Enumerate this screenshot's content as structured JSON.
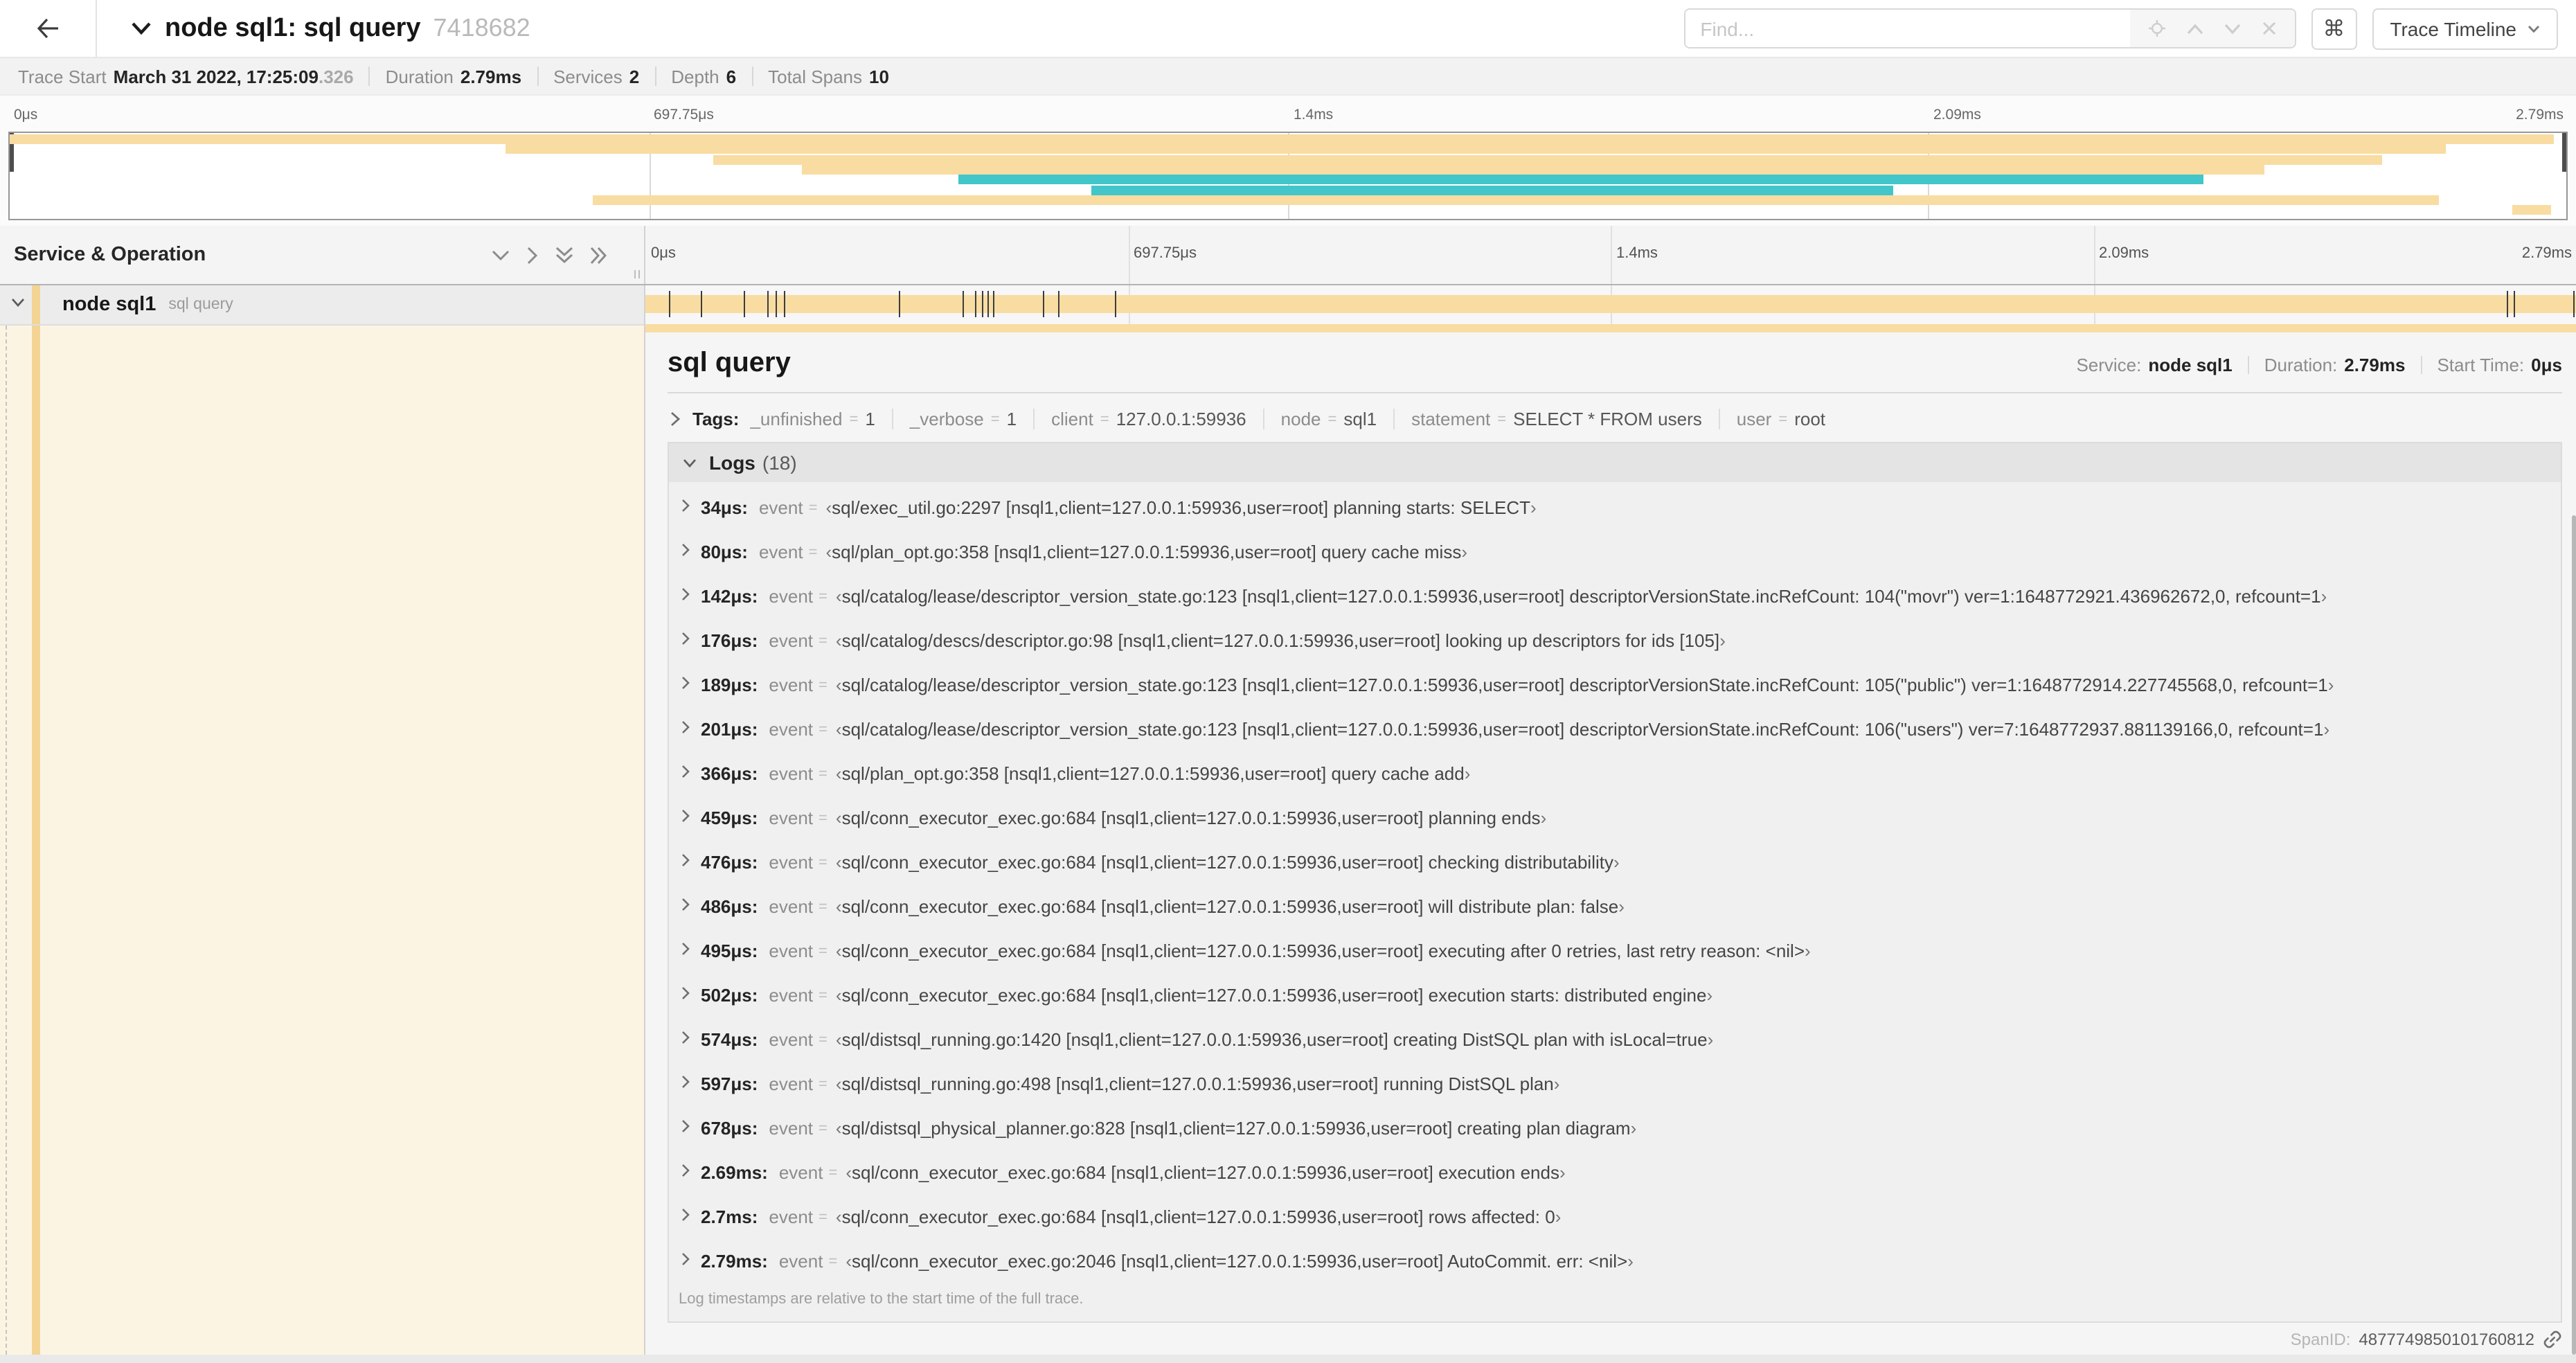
{
  "header": {
    "back_icon": "left-arrow",
    "collapse_icon": "chevron-down",
    "title": "node sql1: sql query",
    "trace_id": "7418682",
    "find_placeholder": "Find...",
    "shortcut_button": "⌘",
    "view_selector": "Trace Timeline"
  },
  "summary": {
    "items": [
      {
        "label": "Trace Start",
        "value": "March 31 2022, 17:25:09",
        "suffix": ".326"
      },
      {
        "label": "Duration",
        "value": "2.79ms",
        "suffix": ""
      },
      {
        "label": "Services",
        "value": "2",
        "suffix": ""
      },
      {
        "label": "Depth",
        "value": "6",
        "suffix": ""
      },
      {
        "label": "Total Spans",
        "value": "10",
        "suffix": ""
      }
    ]
  },
  "colors": {
    "service_node_sql1": "#F8DCA1",
    "service_secondary": "#42C6CA",
    "row_stripe": "#F3D494",
    "detail_tint": "#FCF4E2"
  },
  "minimap": {
    "tick_labels": [
      "0μs",
      "697.75μs",
      "1.4ms",
      "2.09ms",
      "2.79ms"
    ],
    "spans": [
      {
        "row": 0,
        "start": 0,
        "end": 99.5,
        "color": "service_node_sql1"
      },
      {
        "row": 1,
        "start": 19.4,
        "end": 95.3,
        "color": "service_node_sql1"
      },
      {
        "row": 2,
        "start": 27.5,
        "end": 92.8,
        "color": "service_node_sql1"
      },
      {
        "row": 3,
        "start": 31.0,
        "end": 88.2,
        "color": "service_node_sql1"
      },
      {
        "row": 4,
        "start": 37.1,
        "end": 85.8,
        "color": "service_secondary"
      },
      {
        "row": 5,
        "start": 42.3,
        "end": 73.7,
        "color": "service_secondary"
      },
      {
        "row": 6,
        "start": 22.8,
        "end": 95.0,
        "color": "service_node_sql1"
      },
      {
        "row": 7,
        "start": 97.9,
        "end": 99.4,
        "color": "service_node_sql1"
      }
    ]
  },
  "timeline": {
    "left_header": "Service & Operation",
    "ruler_ticks": [
      "0μs",
      "697.75μs",
      "1.4ms",
      "2.09ms",
      "2.79ms"
    ],
    "duration_us": 2790,
    "row": {
      "service": "node sql1",
      "operation": "sql query"
    },
    "log_marks_us": [
      34,
      80,
      142,
      176,
      189,
      201,
      366,
      459,
      476,
      486,
      495,
      502,
      574,
      597,
      678,
      2690,
      2700,
      2790
    ]
  },
  "detail": {
    "operation": "sql query",
    "meta": [
      {
        "label": "Service:",
        "value": "node sql1"
      },
      {
        "label": "Duration:",
        "value": "2.79ms"
      },
      {
        "label": "Start Time:",
        "value": "0μs"
      }
    ],
    "tags_label": "Tags:",
    "tags": [
      {
        "key": "_unfinished",
        "value": "1"
      },
      {
        "key": "_verbose",
        "value": "1"
      },
      {
        "key": "client",
        "value": "127.0.0.1:59936"
      },
      {
        "key": "node",
        "value": "sql1"
      },
      {
        "key": "statement",
        "value": "SELECT * FROM users"
      },
      {
        "key": "user",
        "value": "root"
      }
    ],
    "logs_label": "Logs",
    "logs_count": "(18)",
    "log_field_name": "event",
    "logs": [
      {
        "time": "34μs:",
        "value": "sql/exec_util.go:2297 [nsql1,client=127.0.0.1:59936,user=root] planning starts: SELECT"
      },
      {
        "time": "80μs:",
        "value": "sql/plan_opt.go:358 [nsql1,client=127.0.0.1:59936,user=root] query cache miss"
      },
      {
        "time": "142μs:",
        "value": "sql/catalog/lease/descriptor_version_state.go:123 [nsql1,client=127.0.0.1:59936,user=root] descriptorVersionState.incRefCount: 104(\"movr\") ver=1:1648772921.436962672,0, refcount=1"
      },
      {
        "time": "176μs:",
        "value": "sql/catalog/descs/descriptor.go:98 [nsql1,client=127.0.0.1:59936,user=root] looking up descriptors for ids [105]"
      },
      {
        "time": "189μs:",
        "value": "sql/catalog/lease/descriptor_version_state.go:123 [nsql1,client=127.0.0.1:59936,user=root] descriptorVersionState.incRefCount: 105(\"public\") ver=1:1648772914.227745568,0, refcount=1"
      },
      {
        "time": "201μs:",
        "value": "sql/catalog/lease/descriptor_version_state.go:123 [nsql1,client=127.0.0.1:59936,user=root] descriptorVersionState.incRefCount: 106(\"users\") ver=7:1648772937.881139166,0, refcount=1"
      },
      {
        "time": "366μs:",
        "value": "sql/plan_opt.go:358 [nsql1,client=127.0.0.1:59936,user=root] query cache add"
      },
      {
        "time": "459μs:",
        "value": "sql/conn_executor_exec.go:684 [nsql1,client=127.0.0.1:59936,user=root] planning ends"
      },
      {
        "time": "476μs:",
        "value": "sql/conn_executor_exec.go:684 [nsql1,client=127.0.0.1:59936,user=root] checking distributability"
      },
      {
        "time": "486μs:",
        "value": "sql/conn_executor_exec.go:684 [nsql1,client=127.0.0.1:59936,user=root] will distribute plan: false"
      },
      {
        "time": "495μs:",
        "value": "sql/conn_executor_exec.go:684 [nsql1,client=127.0.0.1:59936,user=root] executing after 0 retries, last retry reason: <nil>"
      },
      {
        "time": "502μs:",
        "value": "sql/conn_executor_exec.go:684 [nsql1,client=127.0.0.1:59936,user=root] execution starts: distributed engine"
      },
      {
        "time": "574μs:",
        "value": "sql/distsql_running.go:1420 [nsql1,client=127.0.0.1:59936,user=root] creating DistSQL plan with isLocal=true"
      },
      {
        "time": "597μs:",
        "value": "sql/distsql_running.go:498 [nsql1,client=127.0.0.1:59936,user=root] running DistSQL plan"
      },
      {
        "time": "678μs:",
        "value": "sql/distsql_physical_planner.go:828 [nsql1,client=127.0.0.1:59936,user=root] creating plan diagram"
      },
      {
        "time": "2.69ms:",
        "value": "sql/conn_executor_exec.go:684 [nsql1,client=127.0.0.1:59936,user=root] execution ends"
      },
      {
        "time": "2.7ms:",
        "value": "sql/conn_executor_exec.go:684 [nsql1,client=127.0.0.1:59936,user=root] rows affected: 0"
      },
      {
        "time": "2.79ms:",
        "value": "sql/conn_executor_exec.go:2046 [nsql1,client=127.0.0.1:59936,user=root] AutoCommit. err: <nil>"
      }
    ],
    "logs_note": "Log timestamps are relative to the start time of the full trace.",
    "span_id_label": "SpanID:",
    "span_id": "4877749850101760812"
  }
}
